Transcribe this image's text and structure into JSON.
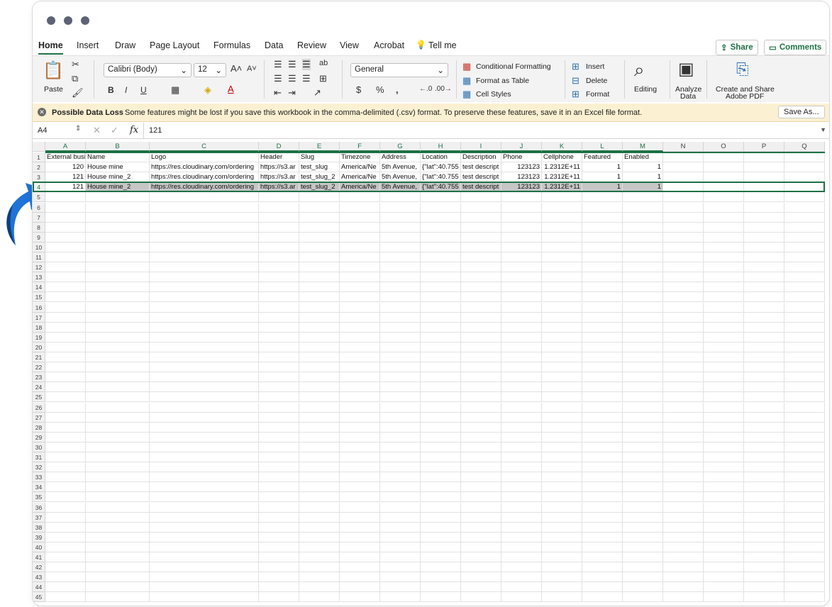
{
  "tabs": [
    "Home",
    "Insert",
    "Draw",
    "Page Layout",
    "Formulas",
    "Data",
    "Review",
    "View",
    "Acrobat",
    "Tell me"
  ],
  "share_label": "Share",
  "comments_label": "Comments",
  "ribbon": {
    "paste": "Paste",
    "font_name": "Calibri (Body)",
    "font_size": "12",
    "number_format": "General",
    "conditional_formatting": "Conditional Formatting",
    "format_as_table": "Format as Table",
    "cell_styles": "Cell Styles",
    "insert": "Insert",
    "delete": "Delete",
    "format": "Format",
    "editing": "Editing",
    "analyze_data_1": "Analyze",
    "analyze_data_2": "Data",
    "create_share_1": "Create and Share",
    "create_share_2": "Adobe PDF"
  },
  "infobar": {
    "title": "Possible Data Loss",
    "message": "Some features might be lost if you save this workbook in the comma-delimited (.csv) format. To preserve these features, save it in an Excel file format.",
    "save_as": "Save As..."
  },
  "formula": {
    "cell_ref": "A4",
    "fx": "fx",
    "value": "121"
  },
  "columns": [
    "A",
    "B",
    "C",
    "D",
    "E",
    "F",
    "G",
    "H",
    "I",
    "J",
    "K",
    "L",
    "M",
    "N",
    "O",
    "P",
    "Q"
  ],
  "rows": [
    [
      "External busi",
      "Name",
      "Logo",
      "Header",
      "Slug",
      "Timezone",
      "Address",
      "Location",
      "Description",
      "Phone",
      "Cellphone",
      "Featured",
      "Enabled"
    ],
    [
      "120",
      "House mine",
      "https://res.cloudinary.com/ordering",
      "https://s3.ar",
      "test_slug",
      "America/Ne",
      "5th Avenue,",
      "{\"lat\":40.755",
      "test descript",
      "123123",
      "1.2312E+11",
      "1",
      "1"
    ],
    [
      "121",
      "House mine_2",
      "https://res.cloudinary.com/ordering",
      "https://s3.ar",
      "test_slug_2",
      "America/Ne",
      "5th Avenue,",
      "{\"lat\":40.755",
      "test descript",
      "123123",
      "1.2312E+11",
      "1",
      "1"
    ],
    [
      "121",
      "House mine_2",
      "https://res.cloudinary.com/ordering",
      "https://s3.ar",
      "test_slug_2",
      "America/Ne",
      "5th Avenue,",
      "{\"lat\":40.755",
      "test descript",
      "123123",
      "1.2312E+11",
      "1",
      "1"
    ]
  ],
  "row_count": 45,
  "colors": {
    "accent": "#1e7145",
    "selection": "#c6c6c6",
    "arrow": "#1f73d6"
  }
}
